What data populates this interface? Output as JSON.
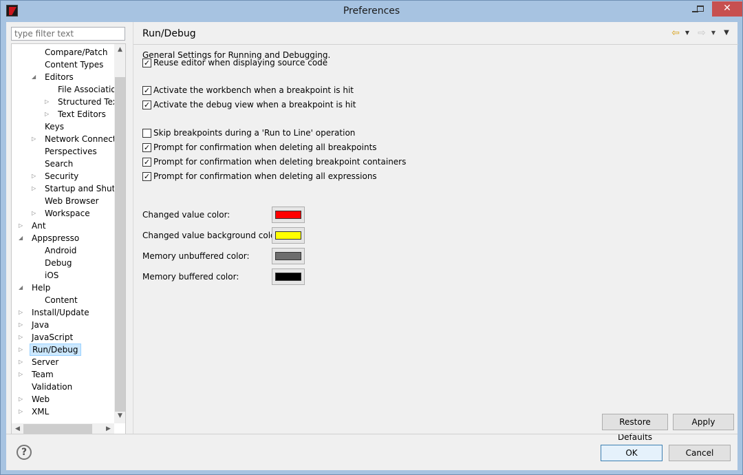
{
  "window": {
    "title": "Preferences"
  },
  "filter": {
    "placeholder": "type filter text"
  },
  "tree": {
    "items": [
      {
        "label": "Compare/Patch",
        "has_children": false,
        "expanded": false
      },
      {
        "label": "Content Types",
        "has_children": false,
        "expanded": false
      },
      {
        "label": "Editors",
        "has_children": true,
        "expanded": true
      },
      {
        "label": "File Associations",
        "has_children": false,
        "expanded": false
      },
      {
        "label": "Structured Text E",
        "has_children": true,
        "expanded": false
      },
      {
        "label": "Text Editors",
        "has_children": true,
        "expanded": false
      },
      {
        "label": "Keys",
        "has_children": false,
        "expanded": false
      },
      {
        "label": "Network Connection",
        "has_children": true,
        "expanded": false
      },
      {
        "label": "Perspectives",
        "has_children": false,
        "expanded": false
      },
      {
        "label": "Search",
        "has_children": false,
        "expanded": false
      },
      {
        "label": "Security",
        "has_children": true,
        "expanded": false
      },
      {
        "label": "Startup and Shutdov",
        "has_children": true,
        "expanded": false
      },
      {
        "label": "Web Browser",
        "has_children": false,
        "expanded": false
      },
      {
        "label": "Workspace",
        "has_children": true,
        "expanded": false
      },
      {
        "label": "Ant",
        "has_children": true,
        "expanded": false
      },
      {
        "label": "Appspresso",
        "has_children": true,
        "expanded": true
      },
      {
        "label": "Android",
        "has_children": false,
        "expanded": false
      },
      {
        "label": "Debug",
        "has_children": false,
        "expanded": false
      },
      {
        "label": "iOS",
        "has_children": false,
        "expanded": false
      },
      {
        "label": "Help",
        "has_children": true,
        "expanded": true
      },
      {
        "label": "Content",
        "has_children": false,
        "expanded": false
      },
      {
        "label": "Install/Update",
        "has_children": true,
        "expanded": false
      },
      {
        "label": "Java",
        "has_children": true,
        "expanded": false
      },
      {
        "label": "JavaScript",
        "has_children": true,
        "expanded": false
      },
      {
        "label": "Run/Debug",
        "has_children": true,
        "expanded": false,
        "selected": true
      },
      {
        "label": "Server",
        "has_children": true,
        "expanded": false
      },
      {
        "label": "Team",
        "has_children": true,
        "expanded": false
      },
      {
        "label": "Validation",
        "has_children": false,
        "expanded": false
      },
      {
        "label": "Web",
        "has_children": true,
        "expanded": false
      },
      {
        "label": "XML",
        "has_children": true,
        "expanded": false
      }
    ]
  },
  "page": {
    "title": "Run/Debug",
    "description": "General Settings for Running and Debugging.",
    "checkboxes": [
      {
        "label": "Reuse editor when displaying source code",
        "checked": true
      },
      {
        "label": "Activate the workbench when a breakpoint is hit",
        "checked": true
      },
      {
        "label": "Activate the debug view when a breakpoint is hit",
        "checked": true
      },
      {
        "label": "Skip breakpoints during a 'Run to Line' operation",
        "checked": false
      },
      {
        "label": "Prompt for confirmation when deleting all breakpoints",
        "checked": true
      },
      {
        "label": "Prompt for confirmation when deleting breakpoint containers",
        "checked": true
      },
      {
        "label": "Prompt for confirmation when deleting all expressions",
        "checked": true
      }
    ],
    "colors": [
      {
        "label": "Changed value color:",
        "color": "#ff0000"
      },
      {
        "label": "Changed value background color:",
        "color": "#ffff00"
      },
      {
        "label": "Memory unbuffered color:",
        "color": "#6d6d6d"
      },
      {
        "label": "Memory buffered color:",
        "color": "#000000"
      }
    ],
    "restore_label": "Restore Defaults",
    "apply_label": "Apply"
  },
  "nav": {
    "back_icon": "back-arrow-icon",
    "forward_icon": "forward-arrow-icon",
    "menu_icon": "view-menu-icon"
  },
  "footer": {
    "help_icon": "help-icon",
    "help_glyph": "?",
    "ok_label": "OK",
    "cancel_label": "Cancel"
  }
}
